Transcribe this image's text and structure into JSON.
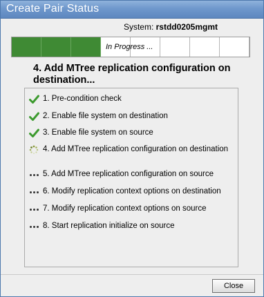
{
  "dialog": {
    "title": "Create Pair Status",
    "system_label": "System:",
    "system_name": "rstdd0205mgmt"
  },
  "progress": {
    "total_segments": 8,
    "completed_segments": 3,
    "status_text": "In Progress ...",
    "done_color": "#3f8a34"
  },
  "current_step_heading": "4. Add MTree replication configuration on destination...",
  "steps": [
    {
      "label": "1. Pre-condition check",
      "status": "done",
      "icon": "check-icon"
    },
    {
      "label": "2. Enable file system on destination",
      "status": "done",
      "icon": "check-icon"
    },
    {
      "label": "3. Enable file system on source",
      "status": "done",
      "icon": "check-icon"
    },
    {
      "label": "4. Add MTree replication configuration on destination",
      "status": "in-progress",
      "icon": "spinner-icon"
    },
    {
      "label": "5. Add MTree replication configuration on source",
      "status": "pending",
      "icon": "pending-dots-icon"
    },
    {
      "label": "6. Modify replication context options on destination",
      "status": "pending",
      "icon": "pending-dots-icon"
    },
    {
      "label": "7. Modify replication context options on source",
      "status": "pending",
      "icon": "pending-dots-icon"
    },
    {
      "label": "8. Start replication initialize on source",
      "status": "pending",
      "icon": "pending-dots-icon"
    }
  ],
  "buttons": {
    "close_label": "Close"
  }
}
